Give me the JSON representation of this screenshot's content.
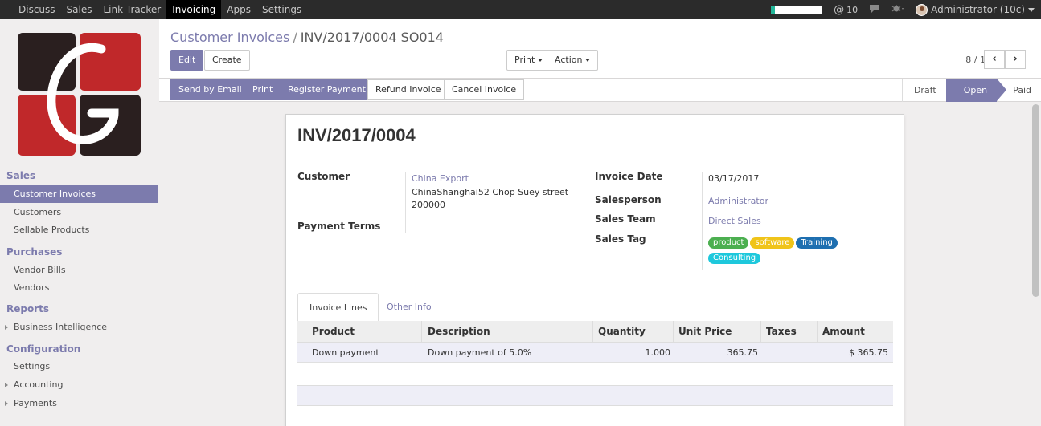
{
  "topbar": {
    "menu": [
      "Discuss",
      "Sales",
      "Link Tracker",
      "Invoicing",
      "Apps",
      "Settings"
    ],
    "active_menu": "Invoicing",
    "progress_fraction": 0.08,
    "mentions": "10",
    "mention_symbol": "@",
    "user": "Administrator (10c)"
  },
  "sidebar": {
    "sections": [
      {
        "title": "Sales",
        "items": [
          "Customer Invoices",
          "Customers",
          "Sellable Products"
        ]
      },
      {
        "title": "Purchases",
        "items": [
          "Vendor Bills",
          "Vendors"
        ]
      },
      {
        "title": "Reports",
        "items": [
          "Business Intelligence"
        ]
      },
      {
        "title": "Configuration",
        "items": [
          "Settings",
          "Accounting",
          "Payments"
        ]
      }
    ],
    "active_item": "Customer Invoices"
  },
  "breadcrumb": {
    "parent": "Customer Invoices",
    "separator": "/",
    "current": "INV/2017/0004 SO014"
  },
  "buttons": {
    "edit": "Edit",
    "create": "Create",
    "print": "Print",
    "action": "Action"
  },
  "pager": {
    "text": "8 / 11",
    "prev": "‹",
    "next": "›"
  },
  "header_buttons": {
    "send_email": "Send by Email",
    "print": "Print",
    "register_payment": "Register Payment",
    "refund": "Refund Invoice",
    "cancel": "Cancel Invoice"
  },
  "statusbar": {
    "stages": [
      "Draft",
      "Open",
      "Paid"
    ],
    "active": "Open"
  },
  "invoice": {
    "number": "INV/2017/0004",
    "customer_label": "Customer",
    "customer_name": "China Export",
    "customer_address_1": "ChinaShanghai52 Chop Suey street",
    "customer_address_2": "200000",
    "payment_terms_label": "Payment Terms",
    "invoice_date_label": "Invoice Date",
    "invoice_date": "03/17/2017",
    "salesperson_label": "Salesperson",
    "salesperson": "Administrator",
    "sales_team_label": "Sales Team",
    "sales_team": "Direct Sales",
    "sales_tag_label": "Sales Tag",
    "tags": [
      {
        "name": "product",
        "color": "#4caf50"
      },
      {
        "name": "software",
        "color": "#f0c419"
      },
      {
        "name": "Training",
        "color": "#1e6fb0"
      },
      {
        "name": "Consulting",
        "color": "#1ec8dc"
      }
    ]
  },
  "tabs": {
    "lines": "Invoice Lines",
    "other": "Other Info"
  },
  "lines_table": {
    "columns": [
      "Product",
      "Description",
      "Quantity",
      "Unit Price",
      "Taxes",
      "Amount"
    ],
    "rows": [
      {
        "product": "Down payment",
        "description": "Down payment of 5.0%",
        "quantity": "1.000",
        "unit_price": "365.75",
        "taxes": "",
        "amount": "$ 365.75"
      }
    ]
  },
  "colors": {
    "accent": "#7c7bad",
    "topbar": "#2b2b2b"
  }
}
